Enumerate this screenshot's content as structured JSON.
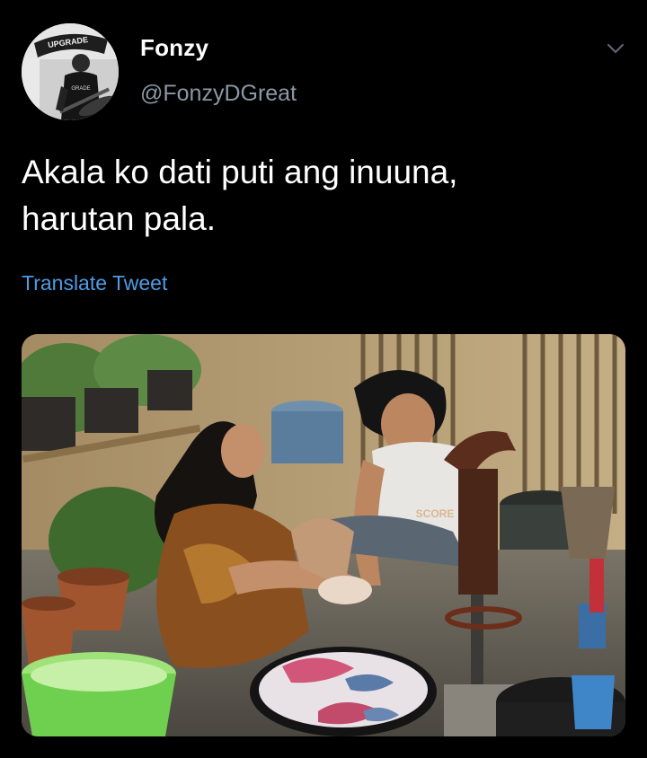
{
  "tweet": {
    "display_name": "Fonzy",
    "handle": "@FonzyDGreat",
    "text_lines": [
      "Akala ko dati puti ang inuuna,",
      "harutan pala."
    ],
    "translate_label": "Translate Tweet"
  },
  "avatar": {
    "banner_text": "UPGRADE",
    "shirt_text": "GRADE"
  },
  "media": {
    "basin_label": "SCORE"
  },
  "colors": {
    "background": "#000000",
    "primary_text": "#ffffff",
    "secondary_text": "#8b98a5",
    "link": "#4f9be6"
  },
  "icons": {
    "menu": "chevron-down-icon"
  }
}
